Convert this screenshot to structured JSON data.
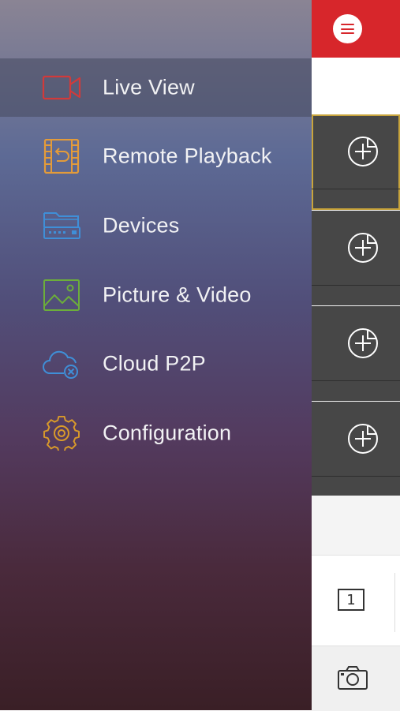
{
  "menu": {
    "items": [
      {
        "label": "Live View",
        "icon": "camera-icon",
        "active": true
      },
      {
        "label": "Remote Playback",
        "icon": "playback-film-icon"
      },
      {
        "label": "Devices",
        "icon": "devices-icon"
      },
      {
        "label": "Picture & Video",
        "icon": "picture-icon"
      },
      {
        "label": "Cloud P2P",
        "icon": "cloud-icon"
      },
      {
        "label": "Configuration",
        "icon": "gear-icon"
      }
    ]
  },
  "live": {
    "split_label": "1"
  },
  "colors": {
    "brand_red": "#d7262b",
    "live_view_icon": "#d23a3a",
    "playback_icon": "#e39b3a",
    "devices_icon": "#3f8fd8",
    "picture_icon": "#6cae3a",
    "cloud_icon": "#3f8fd8",
    "config_icon": "#d99a2a",
    "selected_slot_border": "#c8a43c"
  }
}
